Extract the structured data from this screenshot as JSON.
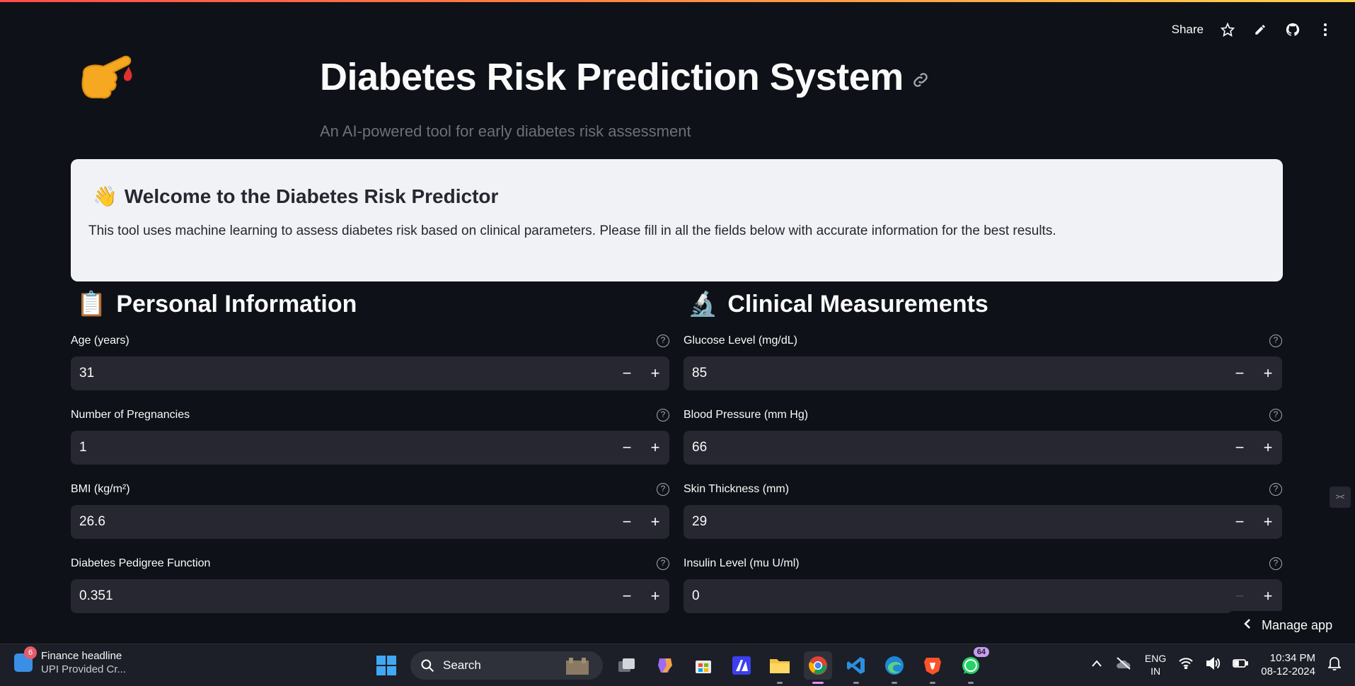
{
  "header": {
    "share_label": "Share",
    "star_icon": "star-icon",
    "edit_icon": "pencil-icon",
    "github_icon": "github-icon",
    "menu_icon": "kebab-menu-icon"
  },
  "hero": {
    "logo": "pointing-finger-blood-drop-logo",
    "title": "Diabetes Risk Prediction System",
    "subtitle": "An AI-powered tool for early diabetes risk assessment"
  },
  "welcome": {
    "emoji": "👋",
    "title": "Welcome to the Diabetes Risk Predictor",
    "text": "This tool uses machine learning to assess diabetes risk based on clinical parameters. Please fill in all the fields below with accurate information for the best results."
  },
  "sections": {
    "personal": {
      "emoji": "📋",
      "title": "Personal Information"
    },
    "clinical": {
      "emoji": "🔬",
      "title": "Clinical Measurements"
    }
  },
  "personal_fields": [
    {
      "label": "Age (years)",
      "value": "31"
    },
    {
      "label": "Number of Pregnancies",
      "value": "1"
    },
    {
      "label": "BMI (kg/m²)",
      "value": "26.6"
    },
    {
      "label": "Diabetes Pedigree Function",
      "value": "0.351"
    }
  ],
  "clinical_fields": [
    {
      "label": "Glucose Level (mg/dL)",
      "value": "85"
    },
    {
      "label": "Blood Pressure (mm Hg)",
      "value": "66"
    },
    {
      "label": "Skin Thickness (mm)",
      "value": "29"
    },
    {
      "label": "Insulin Level (mu U/ml)",
      "value": "0"
    }
  ],
  "stepper": {
    "minus": "−",
    "plus": "+"
  },
  "manage_app": "Manage app",
  "taskbar": {
    "news_badge": "6",
    "news_title": "Finance headline",
    "news_sub": "UPI Provided Cr...",
    "search_label": "Search",
    "whatsapp_badge": "64",
    "lang_top": "ENG",
    "lang_bottom": "IN",
    "time": "10:34 PM",
    "date": "08-12-2024"
  },
  "colors": {
    "background": "#0e1117",
    "card": "#f0f2f6",
    "input": "#262730",
    "accent_gradient_start": "#ff4b4b",
    "accent_gradient_end": "#ffd34f"
  }
}
